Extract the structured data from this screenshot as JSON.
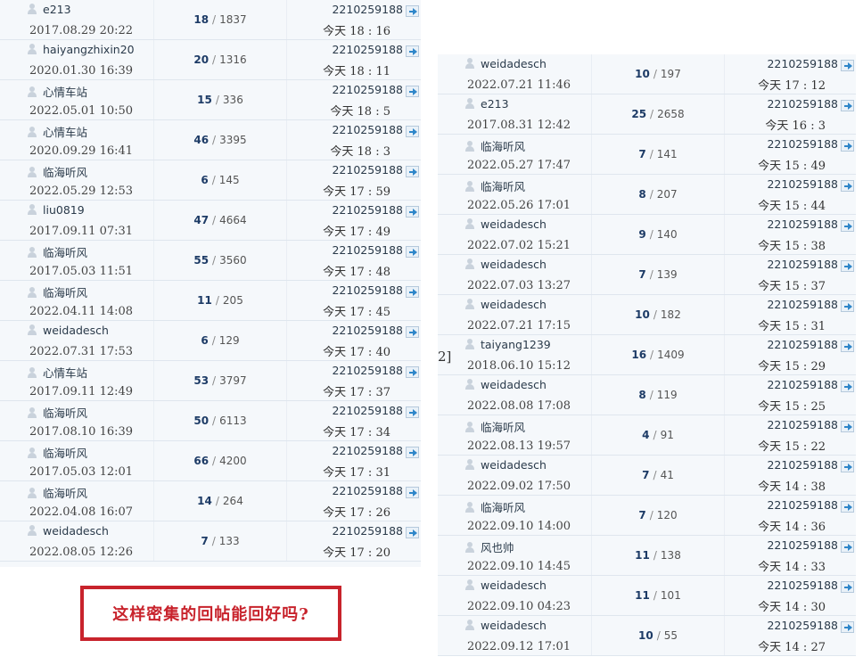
{
  "left_table": {
    "rows": [
      {
        "author": "e213",
        "created": "2017.08.29 20:22",
        "replies": "18",
        "views": "1837",
        "last_user": "2210259188",
        "last_time": "今天 18 : 16"
      },
      {
        "author": "haiyangzhixin20",
        "created": "2020.01.30 16:39",
        "replies": "20",
        "views": "1316",
        "last_user": "2210259188",
        "last_time": "今天 18 : 11"
      },
      {
        "author": "心情车站",
        "created": "2022.05.01 10:50",
        "replies": "15",
        "views": "336",
        "last_user": "2210259188",
        "last_time": "今天 18 : 5"
      },
      {
        "author": "心情车站",
        "created": "2020.09.29 16:41",
        "replies": "46",
        "views": "3395",
        "last_user": "2210259188",
        "last_time": "今天 18 : 3"
      },
      {
        "author": "临海听风",
        "created": "2022.05.29 12:53",
        "replies": "6",
        "views": "145",
        "last_user": "2210259188",
        "last_time": "今天 17 : 59"
      },
      {
        "author": "liu0819",
        "created": "2017.09.11 07:31",
        "replies": "47",
        "views": "4664",
        "last_user": "2210259188",
        "last_time": "今天 17 : 49"
      },
      {
        "author": "临海听风",
        "created": "2017.05.03 11:51",
        "replies": "55",
        "views": "3560",
        "last_user": "2210259188",
        "last_time": "今天 17 : 48"
      },
      {
        "author": "临海听风",
        "created": "2022.04.11 14:08",
        "replies": "11",
        "views": "205",
        "last_user": "2210259188",
        "last_time": "今天 17 : 45"
      },
      {
        "author": "weidadesch",
        "created": "2022.07.31 17:53",
        "replies": "6",
        "views": "129",
        "last_user": "2210259188",
        "last_time": "今天 17 : 40"
      },
      {
        "author": "心情车站",
        "created": "2017.09.11 12:49",
        "replies": "53",
        "views": "3797",
        "last_user": "2210259188",
        "last_time": "今天 17 : 37"
      },
      {
        "author": "临海听风",
        "created": "2017.08.10 16:39",
        "replies": "50",
        "views": "6113",
        "last_user": "2210259188",
        "last_time": "今天 17 : 34"
      },
      {
        "author": "临海听风",
        "created": "2017.05.03 12:01",
        "replies": "66",
        "views": "4200",
        "last_user": "2210259188",
        "last_time": "今天 17 : 31"
      },
      {
        "author": "临海听风",
        "created": "2022.04.08 16:07",
        "replies": "14",
        "views": "264",
        "last_user": "2210259188",
        "last_time": "今天 17 : 26"
      },
      {
        "author": "weidadesch",
        "created": "2022.08.05 12:26",
        "replies": "7",
        "views": "133",
        "last_user": "2210259188",
        "last_time": "今天 17 : 20"
      }
    ]
  },
  "right_table": {
    "rows": [
      {
        "author": "weidadesch",
        "created": "2022.07.21 11:46",
        "replies": "10",
        "views": "197",
        "last_user": "2210259188",
        "last_time": "今天 17 : 12"
      },
      {
        "author": "e213",
        "created": "2017.08.31 12:42",
        "replies": "25",
        "views": "2658",
        "last_user": "2210259188",
        "last_time": "今天 16 : 3"
      },
      {
        "author": "临海听风",
        "created": "2022.05.27 17:47",
        "replies": "7",
        "views": "141",
        "last_user": "2210259188",
        "last_time": "今天 15 : 49"
      },
      {
        "author": "临海听风",
        "created": "2022.05.26 17:01",
        "replies": "8",
        "views": "207",
        "last_user": "2210259188",
        "last_time": "今天 15 : 44"
      },
      {
        "author": "weidadesch",
        "created": "2022.07.02 15:21",
        "replies": "9",
        "views": "140",
        "last_user": "2210259188",
        "last_time": "今天 15 : 38"
      },
      {
        "author": "weidadesch",
        "created": "2022.07.03 13:27",
        "replies": "7",
        "views": "139",
        "last_user": "2210259188",
        "last_time": "今天 15 : 37"
      },
      {
        "author": "weidadesch",
        "created": "2022.07.21 17:15",
        "replies": "10",
        "views": "182",
        "last_user": "2210259188",
        "last_time": "今天 15 : 31"
      },
      {
        "author": "taiyang1239",
        "created": "2018.06.10 15:12",
        "replies": "16",
        "views": "1409",
        "last_user": "2210259188",
        "last_time": "今天 15 : 29"
      },
      {
        "author": "weidadesch",
        "created": "2022.08.08 17:08",
        "replies": "8",
        "views": "119",
        "last_user": "2210259188",
        "last_time": "今天 15 : 25"
      },
      {
        "author": "临海听风",
        "created": "2022.08.13 19:57",
        "replies": "4",
        "views": "91",
        "last_user": "2210259188",
        "last_time": "今天 15 : 22"
      },
      {
        "author": "weidadesch",
        "created": "2022.09.02 17:50",
        "replies": "7",
        "views": "41",
        "last_user": "2210259188",
        "last_time": "今天 14 : 38"
      },
      {
        "author": "临海听风",
        "created": "2022.09.10 14:00",
        "replies": "7",
        "views": "120",
        "last_user": "2210259188",
        "last_time": "今天 14 : 36"
      },
      {
        "author": "风也帅",
        "created": "2022.09.10 14:45",
        "replies": "11",
        "views": "138",
        "last_user": "2210259188",
        "last_time": "今天 14 : 33"
      },
      {
        "author": "weidadesch",
        "created": "2022.09.10 04:23",
        "replies": "11",
        "views": "101",
        "last_user": "2210259188",
        "last_time": "今天 14 : 30"
      },
      {
        "author": "weidadesch",
        "created": "2022.09.12 17:01",
        "replies": "10",
        "views": "55",
        "last_user": "2210259188",
        "last_time": "今天 14 : 27"
      }
    ]
  },
  "separator": "/",
  "page_fragment": "2]",
  "annotation": "这样密集的回帖能回好吗?",
  "colors": {
    "accent_red": "#c8232c",
    "replies_blue": "#1d3b66",
    "row_bg": "#f5f8fb"
  }
}
